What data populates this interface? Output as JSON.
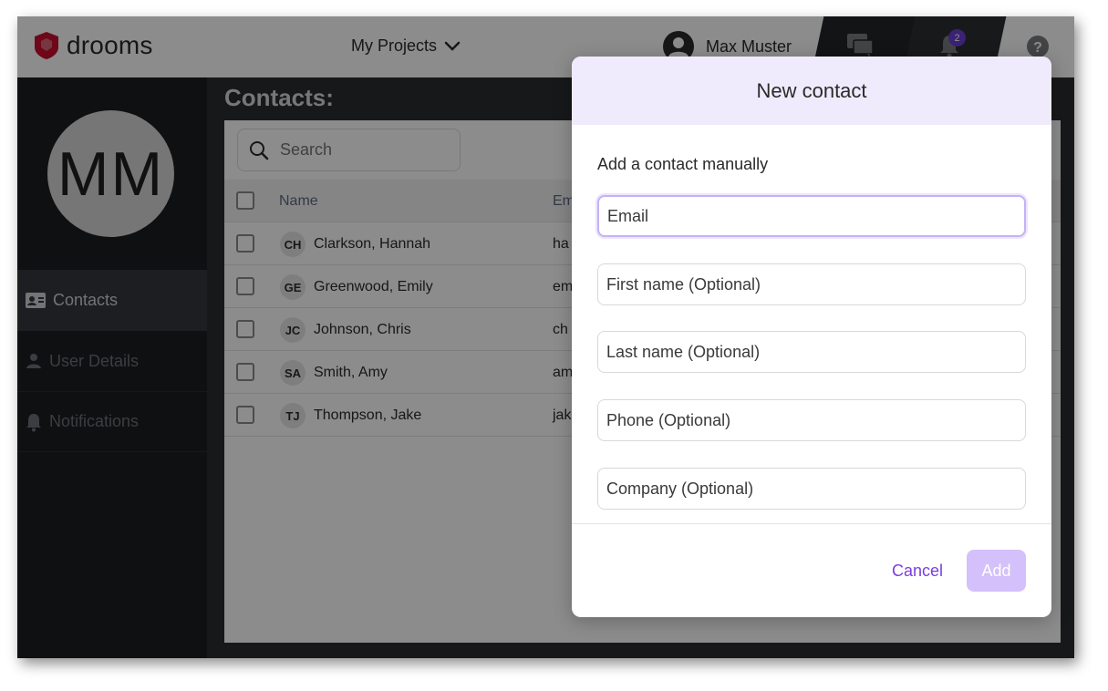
{
  "app": {
    "logo_text": "drooms",
    "brand_color": "#c8102e"
  },
  "header": {
    "projects_label": "My Projects",
    "user_name": "Max Muster",
    "notification_count": "2",
    "icons": [
      "chevron-down-icon",
      "user-avatar-icon",
      "chat-icon",
      "bell-icon",
      "help-icon"
    ]
  },
  "sidebar": {
    "avatar_initials": "MM",
    "items": [
      {
        "label": "Contacts",
        "icon": "contact-card-icon",
        "active": true
      },
      {
        "label": "User Details",
        "icon": "user-icon",
        "active": false
      },
      {
        "label": "Notifications",
        "icon": "bell-icon",
        "active": false
      }
    ]
  },
  "main": {
    "title": "Contacts:",
    "search": {
      "placeholder": "Search"
    },
    "table": {
      "columns": [
        "Name",
        "Em"
      ],
      "rows": [
        {
          "initials": "CH",
          "name": "Clarkson, Hannah",
          "email": "ha"
        },
        {
          "initials": "GE",
          "name": "Greenwood, Emily",
          "email": "em"
        },
        {
          "initials": "JC",
          "name": "Johnson, Chris",
          "email": "ch"
        },
        {
          "initials": "SA",
          "name": "Smith, Amy",
          "email": "am"
        },
        {
          "initials": "TJ",
          "name": "Thompson, Jake",
          "email": "jak"
        }
      ]
    }
  },
  "modal": {
    "title": "New contact",
    "subtitle": "Add a contact manually",
    "fields": {
      "email": {
        "placeholder": "Email",
        "value": ""
      },
      "first_name": {
        "placeholder": "First name (Optional)",
        "value": ""
      },
      "last_name": {
        "placeholder": "Last name (Optional)",
        "value": ""
      },
      "phone": {
        "placeholder": "Phone (Optional)",
        "value": ""
      },
      "company": {
        "placeholder": "Company (Optional)",
        "value": ""
      }
    },
    "cancel_label": "Cancel",
    "add_label": "Add",
    "accent_color": "#7a3ee0"
  }
}
